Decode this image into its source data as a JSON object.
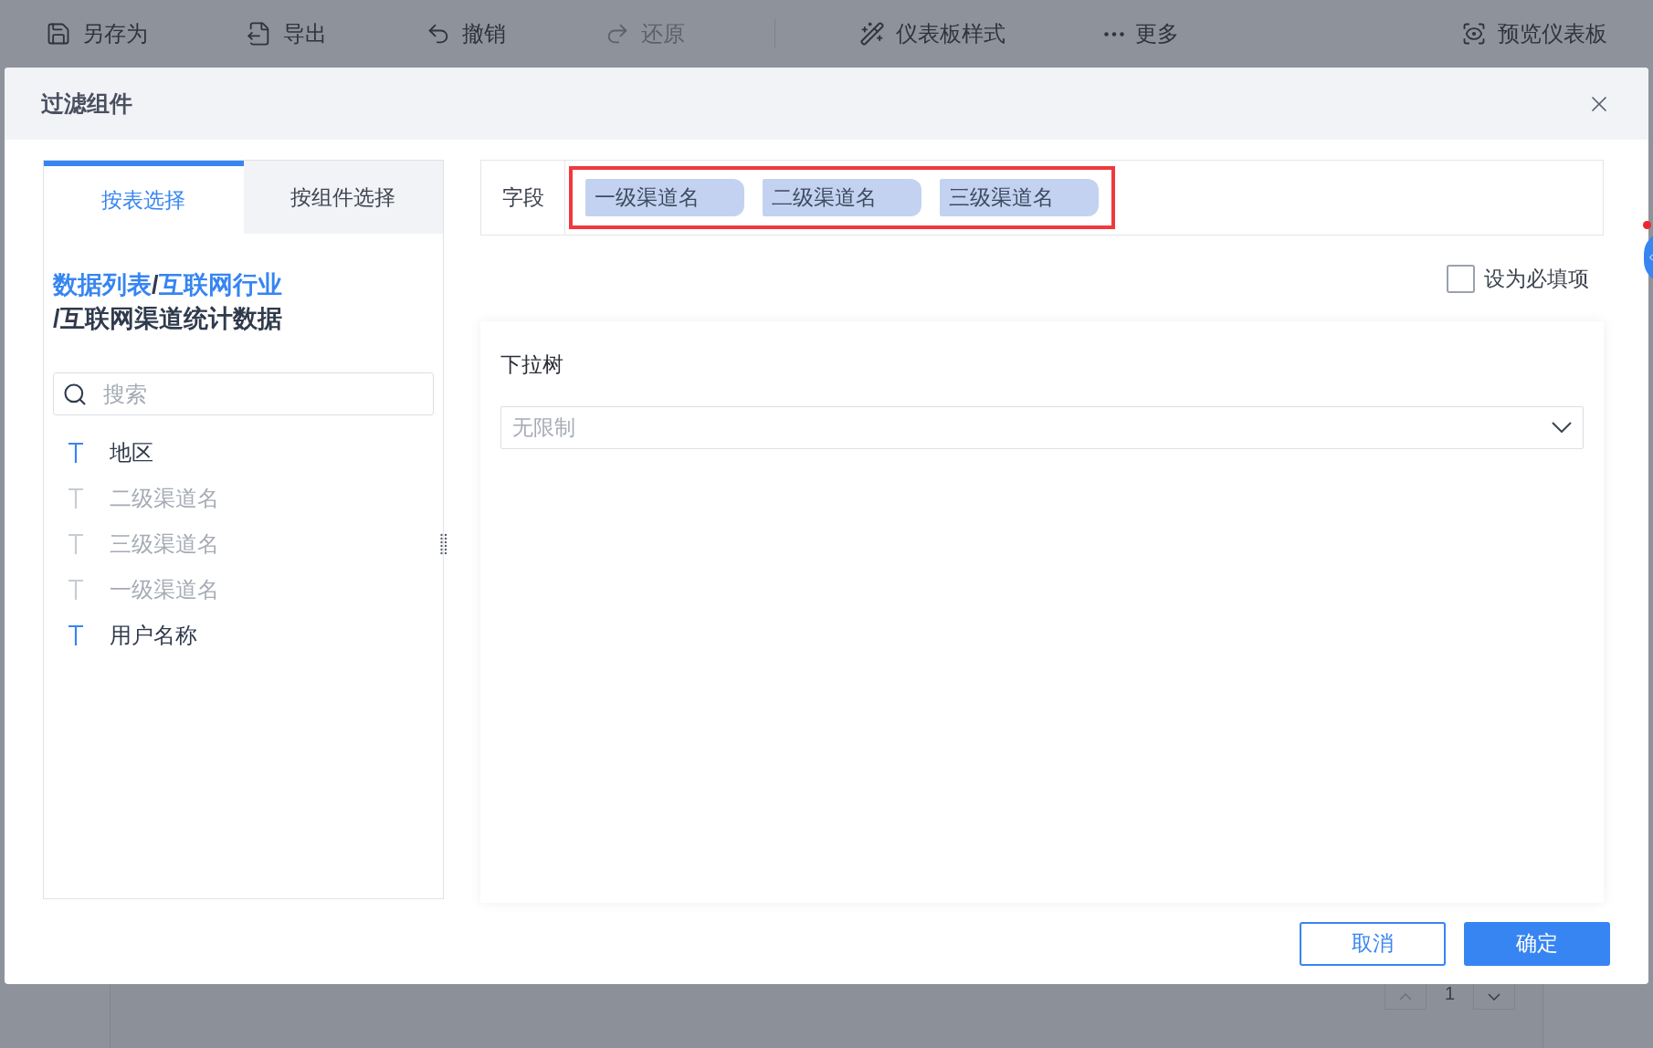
{
  "toolbar": {
    "items": [
      {
        "kind": "save",
        "label": "另存为",
        "disabled": false
      },
      {
        "kind": "export",
        "label": "导出",
        "disabled": false
      },
      {
        "kind": "undo",
        "label": "撤销",
        "disabled": false
      },
      {
        "kind": "redo",
        "label": "还原",
        "disabled": true
      },
      {
        "kind": "divider"
      },
      {
        "kind": "style",
        "label": "仪表板样式",
        "disabled": false
      },
      {
        "kind": "more",
        "label": "更多",
        "disabled": false
      },
      {
        "kind": "spacer"
      },
      {
        "kind": "preview",
        "label": "预览仪表板",
        "disabled": false
      }
    ]
  },
  "dialog": {
    "title": "过滤组件",
    "tabs": [
      {
        "label": "按表选择",
        "selected": true
      },
      {
        "label": "按组件选择",
        "selected": false
      }
    ],
    "breadcrumb_lines": [
      [
        {
          "text": "数据列表",
          "link": true
        },
        {
          "text": "/",
          "link": false
        },
        {
          "text": "互联网行业",
          "link": true
        }
      ],
      [
        {
          "text": "/互联网渠道统计数据",
          "link": false
        }
      ]
    ],
    "search": {
      "placeholder": "搜索"
    },
    "fields": [
      {
        "name": "地区",
        "enabled": true
      },
      {
        "name": "二级渠道名",
        "enabled": false
      },
      {
        "name": "三级渠道名",
        "enabled": false
      },
      {
        "name": "一级渠道名",
        "enabled": false
      },
      {
        "name": "用户名称",
        "enabled": true
      }
    ],
    "field_row": {
      "label": "字段",
      "tags": [
        "一级渠道名",
        "二级渠道名",
        "三级渠道名"
      ]
    },
    "required": {
      "label": "设为必填项",
      "checked": false
    },
    "widget": {
      "title": "下拉树",
      "select": {
        "value": "无限制"
      }
    },
    "buttons": [
      {
        "label": "取消",
        "kind": "secondary"
      },
      {
        "label": "确定",
        "kind": "primary"
      }
    ]
  },
  "background_pager": {
    "page": "1"
  }
}
